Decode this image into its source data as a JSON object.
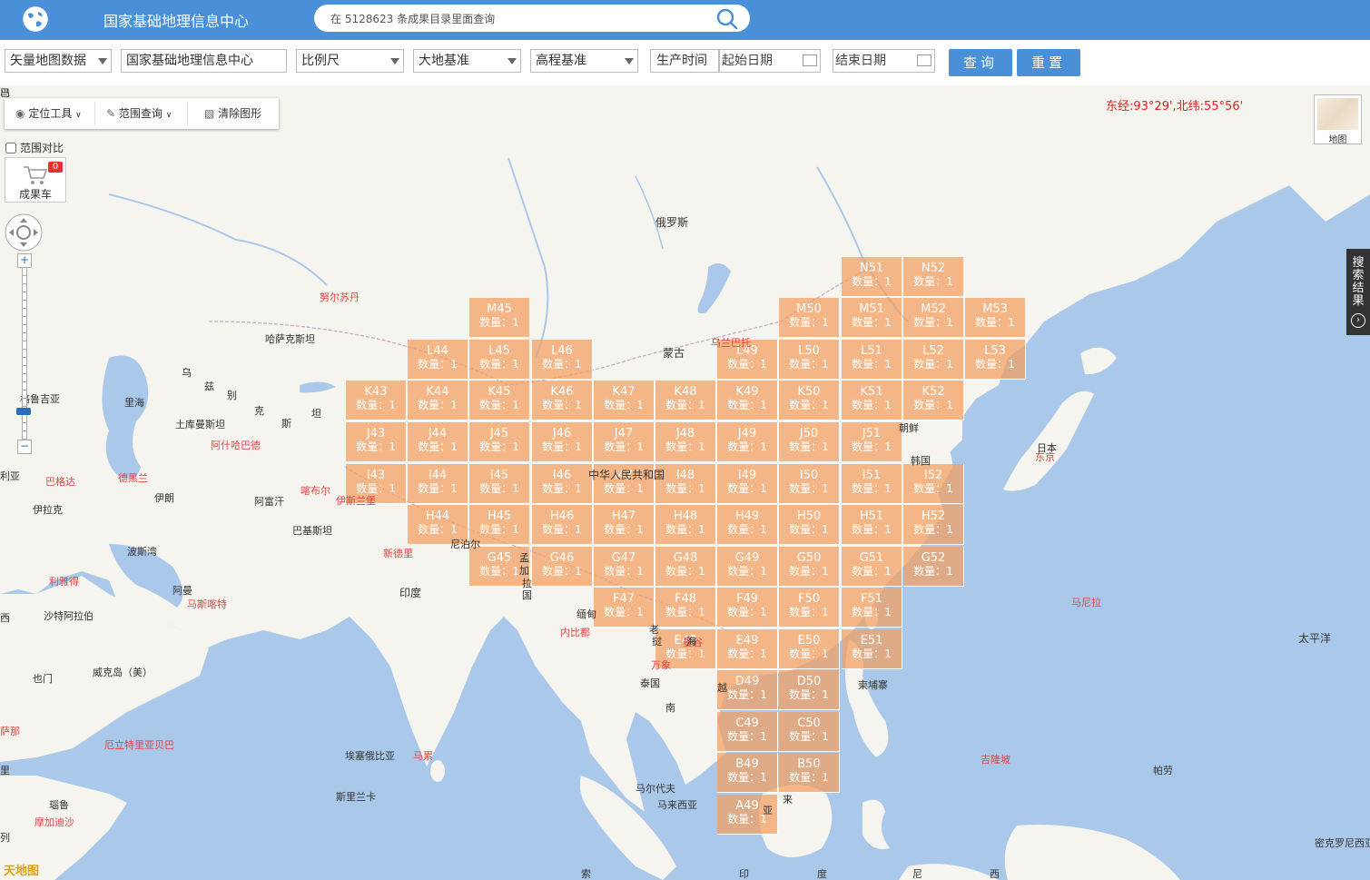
{
  "header": {
    "title": "国家基础地理信息中心",
    "search_placeholder": "在 5128623 条成果目录里面查询"
  },
  "filters": {
    "dataset": "矢量地图数据",
    "organization": "国家基础地理信息中心",
    "scale": "比例尺",
    "geodetic_datum": "大地基准",
    "height_datum": "高程基准",
    "time_label": "生产时间",
    "start_placeholder": "起始日期",
    "end_placeholder": "结束日期",
    "query_label": "查询",
    "reset_label": "重置"
  },
  "toolbar": {
    "locate": "定位工具",
    "range_query": "范围查询",
    "clear": "清除图形",
    "compare": "范围对比"
  },
  "cart": {
    "label": "成果车",
    "count": "0"
  },
  "coordinate": "东经:93°29',北纬:55°56'",
  "layer_switch": "地图",
  "results_tab": "搜索结果",
  "brand_logo": "天地图",
  "count_prefix": "数量：",
  "tiles": [
    {
      "id": "N51",
      "count": "1"
    },
    {
      "id": "N52",
      "count": "1"
    },
    {
      "id": "M45",
      "count": "1"
    },
    {
      "id": "M50",
      "count": "1"
    },
    {
      "id": "M51",
      "count": "1"
    },
    {
      "id": "M52",
      "count": "1"
    },
    {
      "id": "M53",
      "count": "1"
    },
    {
      "id": "L44",
      "count": "1"
    },
    {
      "id": "L45",
      "count": "1"
    },
    {
      "id": "L46",
      "count": "1"
    },
    {
      "id": "L49",
      "count": "1"
    },
    {
      "id": "L50",
      "count": "1"
    },
    {
      "id": "L51",
      "count": "1"
    },
    {
      "id": "L52",
      "count": "1"
    },
    {
      "id": "L53",
      "count": "1"
    },
    {
      "id": "K43",
      "count": "1"
    },
    {
      "id": "K44",
      "count": "1"
    },
    {
      "id": "K45",
      "count": "1"
    },
    {
      "id": "K46",
      "count": "1"
    },
    {
      "id": "K47",
      "count": "1"
    },
    {
      "id": "K48",
      "count": "1"
    },
    {
      "id": "K49",
      "count": "1"
    },
    {
      "id": "K50",
      "count": "1"
    },
    {
      "id": "K51",
      "count": "1"
    },
    {
      "id": "K52",
      "count": "1"
    },
    {
      "id": "J43",
      "count": "1"
    },
    {
      "id": "J44",
      "count": "1"
    },
    {
      "id": "J45",
      "count": "1"
    },
    {
      "id": "J46",
      "count": "1"
    },
    {
      "id": "J47",
      "count": "1"
    },
    {
      "id": "J48",
      "count": "1"
    },
    {
      "id": "J49",
      "count": "1"
    },
    {
      "id": "J50",
      "count": "1"
    },
    {
      "id": "J51",
      "count": "1"
    },
    {
      "id": "I43",
      "count": "1"
    },
    {
      "id": "I44",
      "count": "1"
    },
    {
      "id": "I45",
      "count": "1"
    },
    {
      "id": "I46",
      "count": "1"
    },
    {
      "id": "I47",
      "count": "1"
    },
    {
      "id": "I48",
      "count": "1"
    },
    {
      "id": "I49",
      "count": "1"
    },
    {
      "id": "I50",
      "count": "1"
    },
    {
      "id": "I51",
      "count": "1"
    },
    {
      "id": "I52",
      "count": "1"
    },
    {
      "id": "H44",
      "count": "1"
    },
    {
      "id": "H45",
      "count": "1"
    },
    {
      "id": "H46",
      "count": "1"
    },
    {
      "id": "H47",
      "count": "1"
    },
    {
      "id": "H48",
      "count": "1"
    },
    {
      "id": "H49",
      "count": "1"
    },
    {
      "id": "H50",
      "count": "1"
    },
    {
      "id": "H51",
      "count": "1"
    },
    {
      "id": "H52",
      "count": "1"
    },
    {
      "id": "G45",
      "count": "1"
    },
    {
      "id": "G46",
      "count": "1"
    },
    {
      "id": "G47",
      "count": "1"
    },
    {
      "id": "G48",
      "count": "1"
    },
    {
      "id": "G49",
      "count": "1"
    },
    {
      "id": "G50",
      "count": "1"
    },
    {
      "id": "G51",
      "count": "1"
    },
    {
      "id": "G52",
      "count": "1"
    },
    {
      "id": "F47",
      "count": "1"
    },
    {
      "id": "F48",
      "count": "1"
    },
    {
      "id": "F49",
      "count": "1"
    },
    {
      "id": "F50",
      "count": "1"
    },
    {
      "id": "F51",
      "count": "1"
    },
    {
      "id": "E48",
      "count": "1"
    },
    {
      "id": "E49",
      "count": "1"
    },
    {
      "id": "E50",
      "count": "1"
    },
    {
      "id": "E51",
      "count": "1"
    },
    {
      "id": "D49",
      "count": "1"
    },
    {
      "id": "D50",
      "count": "1"
    },
    {
      "id": "C49",
      "count": "1"
    },
    {
      "id": "C50",
      "count": "1"
    },
    {
      "id": "B49",
      "count": "1"
    },
    {
      "id": "B50",
      "count": "1"
    },
    {
      "id": "A49",
      "count": "1"
    }
  ],
  "places": [
    {
      "text": "俄罗斯",
      "style": "big"
    },
    {
      "text": "努尔苏丹",
      "style": "red"
    },
    {
      "text": "哈萨克斯坦",
      "style": ""
    },
    {
      "text": "蒙古",
      "style": "big"
    },
    {
      "text": "乌兰巴托",
      "style": "red"
    },
    {
      "text": "乌",
      "style": ""
    },
    {
      "text": "兹",
      "style": ""
    },
    {
      "text": "别",
      "style": ""
    },
    {
      "text": "克",
      "style": ""
    },
    {
      "text": "斯",
      "style": ""
    },
    {
      "text": "坦",
      "style": ""
    },
    {
      "text": "格鲁吉亚",
      "style": ""
    },
    {
      "text": "里海",
      "style": ""
    },
    {
      "text": "土库曼斯坦",
      "style": ""
    },
    {
      "text": "阿什哈巴德",
      "style": "red"
    },
    {
      "text": "利亚",
      "style": ""
    },
    {
      "text": "巴格达",
      "style": "red"
    },
    {
      "text": "德黑兰",
      "style": "red"
    },
    {
      "text": "伊朗",
      "style": ""
    },
    {
      "text": "阿富汗",
      "style": ""
    },
    {
      "text": "喀布尔",
      "style": "red"
    },
    {
      "text": "伊斯兰堡",
      "style": "red"
    },
    {
      "text": "伊拉克",
      "style": ""
    },
    {
      "text": "巴基斯坦",
      "style": ""
    },
    {
      "text": "中华人民共和国",
      "style": "big"
    },
    {
      "text": "朝鲜",
      "style": ""
    },
    {
      "text": "韩国",
      "style": ""
    },
    {
      "text": "日本",
      "style": ""
    },
    {
      "text": "东京",
      "style": "red"
    },
    {
      "text": "新德里",
      "style": "red"
    },
    {
      "text": "尼泊尔",
      "style": ""
    },
    {
      "text": "波斯湾",
      "style": ""
    },
    {
      "text": "利雅得",
      "style": "red"
    },
    {
      "text": "阿曼",
      "style": ""
    },
    {
      "text": "马斯喀特",
      "style": "red"
    },
    {
      "text": "沙特阿拉伯",
      "style": ""
    },
    {
      "text": "印度",
      "style": "big"
    },
    {
      "text": "孟",
      "style": ""
    },
    {
      "text": "加",
      "style": ""
    },
    {
      "text": "拉",
      "style": ""
    },
    {
      "text": "国",
      "style": ""
    },
    {
      "text": "缅甸",
      "style": ""
    },
    {
      "text": "内比都",
      "style": "red"
    },
    {
      "text": "老",
      "style": ""
    },
    {
      "text": "挝",
      "style": ""
    },
    {
      "text": "万象",
      "style": "red"
    },
    {
      "text": "泰国",
      "style": ""
    },
    {
      "text": "曼谷",
      "style": "red"
    },
    {
      "text": "越",
      "style": ""
    },
    {
      "text": "南",
      "style": ""
    },
    {
      "text": "柬埔寨",
      "style": ""
    },
    {
      "text": "马尼拉",
      "style": "red"
    },
    {
      "text": "太平洋",
      "style": "big"
    },
    {
      "text": "威克岛（美）",
      "style": ""
    },
    {
      "text": "也门",
      "style": ""
    },
    {
      "text": "萨那",
      "style": "red"
    },
    {
      "text": "厄立特里亚贝巴",
      "style": "red"
    },
    {
      "text": "里",
      "style": ""
    },
    {
      "text": "埃塞俄比亚",
      "style": ""
    },
    {
      "text": "马累",
      "style": "red"
    },
    {
      "text": "斯里兰卡",
      "style": ""
    },
    {
      "text": "马尔代夫",
      "style": ""
    },
    {
      "text": "马来西亚",
      "style": ""
    },
    {
      "text": "吉隆坡",
      "style": "red"
    },
    {
      "text": "帕劳",
      "style": ""
    },
    {
      "text": "密克罗尼西亚联邦",
      "style": ""
    },
    {
      "text": "瑙鲁",
      "style": ""
    },
    {
      "text": "摩加迪沙",
      "style": "red"
    },
    {
      "text": "索",
      "style": ""
    },
    {
      "text": "印",
      "style": ""
    },
    {
      "text": "度",
      "style": ""
    },
    {
      "text": "尼",
      "style": ""
    },
    {
      "text": "西",
      "style": ""
    },
    {
      "text": "亚",
      "style": ""
    },
    {
      "text": "来",
      "style": ""
    },
    {
      "text": "西",
      "style": ""
    },
    {
      "text": "海",
      "style": ""
    },
    {
      "text": "列",
      "style": ""
    },
    {
      "text": "马",
      "style": ""
    },
    {
      "text": "巴",
      "style": ""
    }
  ]
}
